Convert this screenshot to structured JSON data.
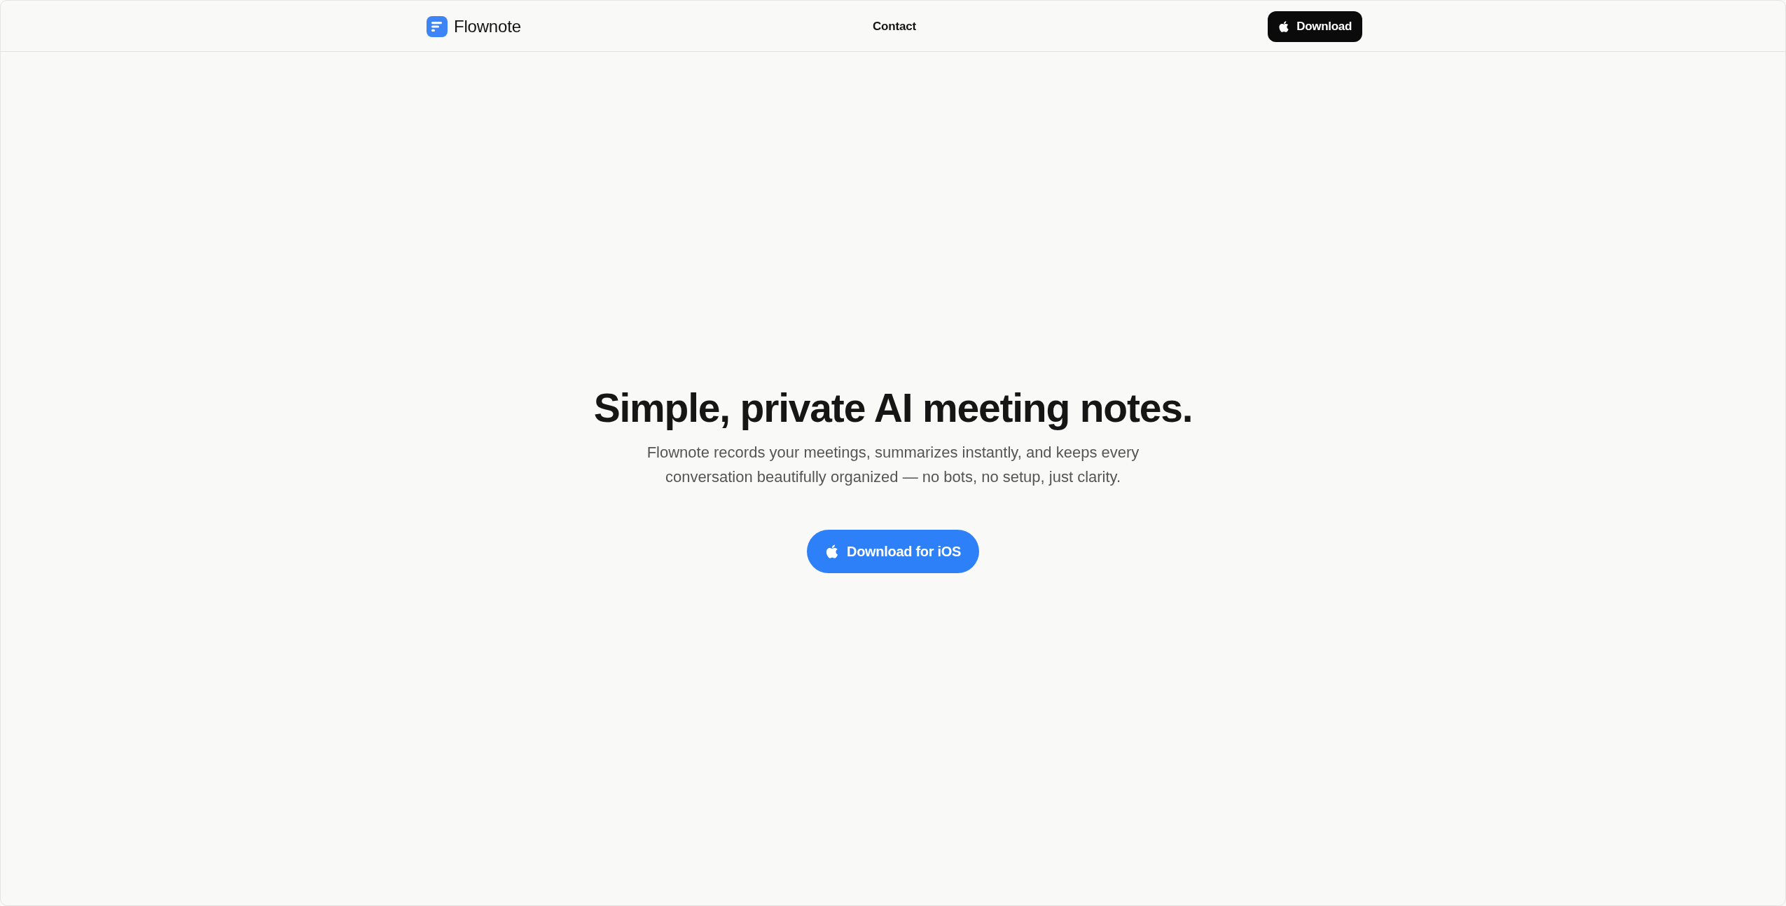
{
  "header": {
    "logo": {
      "name": "Flownote"
    },
    "nav": [
      {
        "label": "Contact"
      }
    ],
    "download_button": {
      "label": "Download"
    }
  },
  "hero": {
    "title": "Simple, private AI meeting notes.",
    "subtitle": "Flownote records your meetings, summarizes instantly, and keeps every conversation beautifully organized — no bots, no setup, just clarity.",
    "cta": {
      "label": "Download for iOS"
    }
  }
}
